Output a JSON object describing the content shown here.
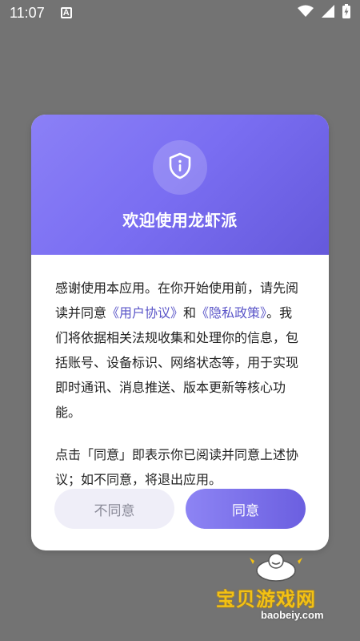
{
  "status_bar": {
    "time": "11:07",
    "notification_glyph": "A"
  },
  "dialog": {
    "title": "欢迎使用龙虾派",
    "body": {
      "seg1": "感谢使用本应用。在你开始使用前，请先阅读并同意",
      "user_agreement_link": "《用户协议》",
      "seg2": "和",
      "privacy_policy_link": "《隐私政策》",
      "seg3": "。我们将依据相关法规收集和处理你的信息，包括账号、设备标识、网络状态等，用于实现即时通讯、消息推送、版本更新等核心功能。",
      "para2": "点击「同意」即表示你已阅读并同意上述协议；如不同意，将退出应用。"
    },
    "decline_label": "不同意",
    "accept_label": "同意"
  },
  "watermark": {
    "name": "宝贝游戏网",
    "url": "baobeiy.com"
  },
  "colors": {
    "accent": "#7a6ef2",
    "link": "#5a55c8"
  },
  "icons": {
    "header": "shield-info-icon",
    "status": [
      "wifi-icon",
      "cell-signal-icon",
      "battery-charging-icon"
    ]
  }
}
